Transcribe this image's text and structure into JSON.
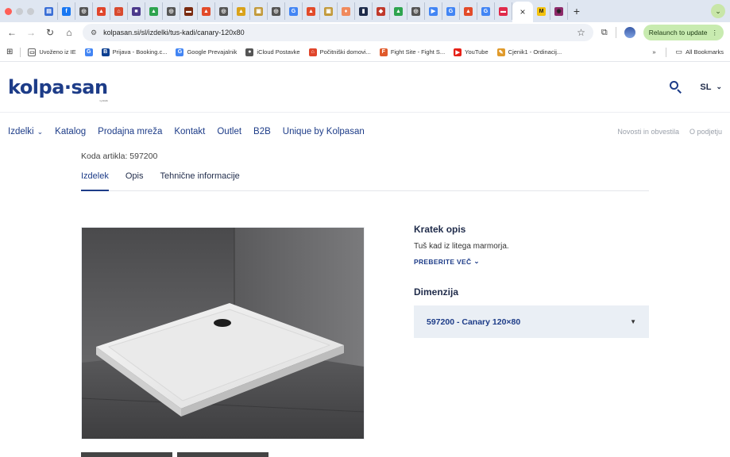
{
  "browser": {
    "address_url": "kolpasan.si/sl/izdelki/tus-kadi/canary-120x80",
    "relaunch_label": "Relaunch to update",
    "tabs": [
      {
        "icon": "news-icon",
        "color": "#3b6fd6",
        "glyph": "▤"
      },
      {
        "icon": "facebook-icon",
        "color": "#1877f2",
        "glyph": "f"
      },
      {
        "icon": "globe-icon",
        "color": "#555",
        "glyph": "◎"
      },
      {
        "icon": "flame-icon",
        "color": "#e0452b",
        "glyph": "▲"
      },
      {
        "icon": "triangle-icon",
        "color": "#d84a2f",
        "glyph": "⌂"
      },
      {
        "icon": "pixel-icon",
        "color": "#4b3a8c",
        "glyph": "■"
      },
      {
        "icon": "drive-icon",
        "color": "#2ea44f",
        "glyph": "▲"
      },
      {
        "icon": "globe-icon",
        "color": "#555",
        "glyph": "◎"
      },
      {
        "icon": "car-icon",
        "color": "#7a2a10",
        "glyph": "▬"
      },
      {
        "icon": "fire-icon",
        "color": "#e24b2a",
        "glyph": "▲"
      },
      {
        "icon": "globe-icon",
        "color": "#555",
        "glyph": "◎"
      },
      {
        "icon": "ship-icon",
        "color": "#d9a21a",
        "glyph": "▲"
      },
      {
        "icon": "calendar-icon",
        "color": "#c29a3b",
        "glyph": "▣"
      },
      {
        "icon": "globe-icon",
        "color": "#555",
        "glyph": "◎"
      },
      {
        "icon": "google-icon",
        "color": "#4285f4",
        "glyph": "G"
      },
      {
        "icon": "fire-icon",
        "color": "#e24b2a",
        "glyph": "▲"
      },
      {
        "icon": "calendar-icon",
        "color": "#c29a3b",
        "glyph": "▣"
      },
      {
        "icon": "flame-icon",
        "color": "#f08a5d",
        "glyph": "♦"
      },
      {
        "icon": "book-icon",
        "color": "#1d2b4a",
        "glyph": "▮"
      },
      {
        "icon": "diamond-icon",
        "color": "#c0392b",
        "glyph": "◆"
      },
      {
        "icon": "drive-icon",
        "color": "#2ea44f",
        "glyph": "▲"
      },
      {
        "icon": "globe-icon",
        "color": "#555",
        "glyph": "◎"
      },
      {
        "icon": "translate-icon",
        "color": "#4285f4",
        "glyph": "▶"
      },
      {
        "icon": "google-icon",
        "color": "#4285f4",
        "glyph": "G"
      },
      {
        "icon": "fire-icon",
        "color": "#e24b2a",
        "glyph": "▲"
      },
      {
        "icon": "google-icon",
        "color": "#4285f4",
        "glyph": "G"
      },
      {
        "icon": "kolpa-icon",
        "color": "#e02a4a",
        "glyph": "▬"
      }
    ],
    "tabs_after": [
      {
        "icon": "mail-icon",
        "color": "#f4c20d",
        "glyph": "M"
      },
      {
        "icon": "profile-icon",
        "color": "#8e2a6a",
        "glyph": "◉"
      }
    ],
    "bookmarks": [
      {
        "label": "Uvoženo iz IE",
        "icon": "folder-icon",
        "color": "#ffffff",
        "glyph": "▭"
      },
      {
        "label": "",
        "icon": "google-icon",
        "color": "#4285f4",
        "glyph": "G"
      },
      {
        "label": "Prijava - Booking.c...",
        "icon": "booking-icon",
        "color": "#0b3f91",
        "glyph": "B"
      },
      {
        "label": "Google Prevajalnik",
        "icon": "translate-icon",
        "color": "#4285f4",
        "glyph": "G"
      },
      {
        "label": "iCloud Postavke",
        "icon": "apple-icon",
        "color": "#555555",
        "glyph": "●"
      },
      {
        "label": "Počitniški domovi...",
        "icon": "house-icon",
        "color": "#e0452b",
        "glyph": "⌂"
      },
      {
        "label": "Fight Site - Fight S...",
        "icon": "fight-icon",
        "color": "#e05a2b",
        "glyph": "F"
      },
      {
        "label": "YouTube",
        "icon": "youtube-icon",
        "color": "#e62117",
        "glyph": "▶"
      },
      {
        "label": "Cjenik1 - Ordinacij...",
        "icon": "bookmark-icon",
        "color": "#e09a2b",
        "glyph": "✎"
      }
    ],
    "all_bookmarks_label": "All Bookmarks",
    "overflow_label": "»"
  },
  "site": {
    "logo_text": "kolpa·san",
    "logo_subtext": "by KOLPA",
    "language": "SL",
    "nav": {
      "products": "Izdelki",
      "catalog": "Katalog",
      "sales_network": "Prodajna mreža",
      "contact": "Kontakt",
      "outlet": "Outlet",
      "b2b": "B2B",
      "unique": "Unique by Kolpasan",
      "news": "Novosti in obvestila",
      "about": "O podjetju"
    }
  },
  "product": {
    "sku_label": "Koda artikla: 597200",
    "tabs": [
      "Izdelek",
      "Opis",
      "Tehnične informacije"
    ],
    "short_desc_title": "Kratek opis",
    "short_desc": "Tuš kad iz litega marmorja.",
    "read_more": "PREBERITE VEČ",
    "dimension_title": "Dimenzija",
    "dimension_value": "597200 - Canary 120×80"
  }
}
